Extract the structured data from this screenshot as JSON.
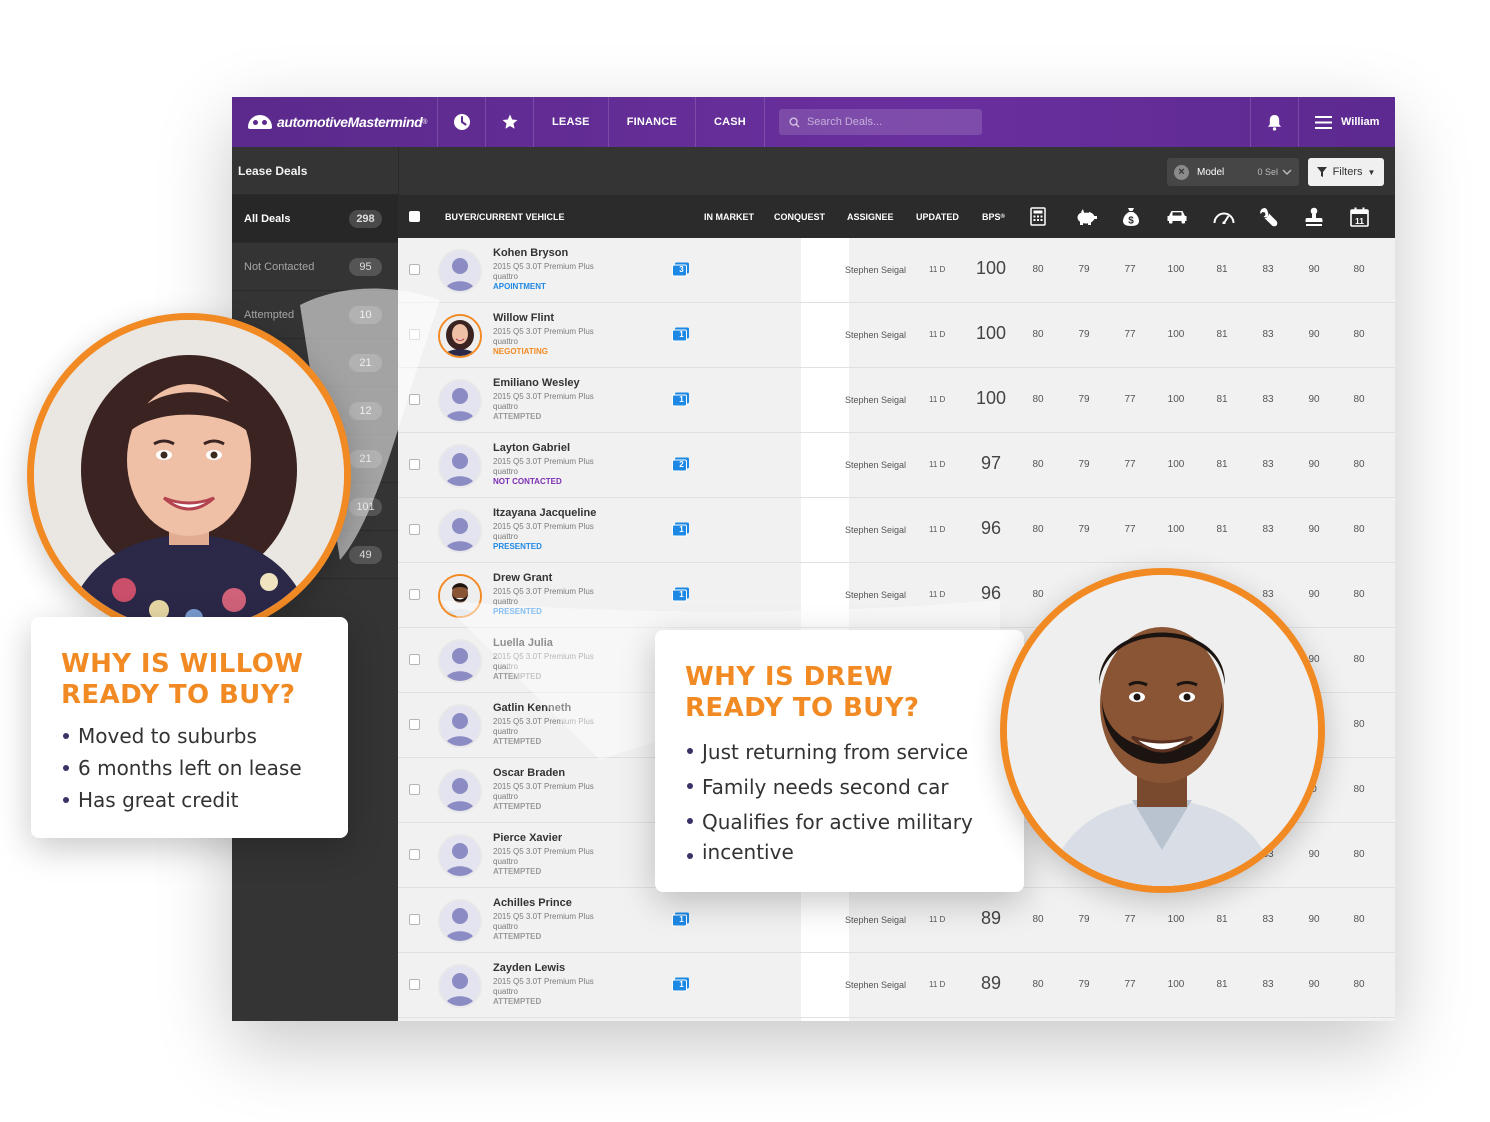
{
  "brand": {
    "name": "automotiveMastermind",
    "reg": "®"
  },
  "nav": {
    "links": [
      "LEASE",
      "FINANCE",
      "CASH"
    ],
    "search_placeholder": "Search Deals...",
    "user": "William"
  },
  "colors": {
    "topbar": "#5b2a8c",
    "accent": "#f28a24",
    "appointment": "#1e88e5",
    "negotiating": "#f28a24",
    "attempted": "#9a9a9a",
    "not_contacted": "#7b2fb5",
    "presented": "#1e88e5"
  },
  "sidebar": {
    "title": "Lease Deals",
    "items": [
      {
        "label": "All Deals",
        "count": "298"
      },
      {
        "label": "Not Contacted",
        "count": "95"
      },
      {
        "label": "Attempted",
        "count": "10"
      },
      {
        "label": "",
        "count": "21"
      },
      {
        "label": "",
        "count": "12"
      },
      {
        "label": "",
        "count": "21"
      },
      {
        "label": "",
        "count": "101"
      },
      {
        "label": "",
        "count": "49"
      }
    ]
  },
  "toolbar": {
    "model_label": "Model",
    "model_sel": "0 Sel",
    "filters_label": "Filters"
  },
  "table": {
    "headers": {
      "buyer": "BUYER/CURRENT VEHICLE",
      "in_market": "IN MARKET",
      "conquest": "CONQUEST",
      "assignee": "ASSIGNEE",
      "updated": "UPDATED",
      "bps": "BPS",
      "bps_sup": "®"
    },
    "icon_columns": [
      "calculator-icon",
      "piggy-bank-icon",
      "money-bag-icon",
      "car-icon",
      "speedometer-icon",
      "wrench-icon",
      "stamp-icon",
      "calendar-icon"
    ],
    "calendar_day": "11",
    "rows": [
      {
        "name": "Kohen Bryson",
        "vehicle": [
          "2015 Q5 3.0T Premium Plus",
          "quattro"
        ],
        "status": "APOINTMENT",
        "status_type": "appointment",
        "in_market": "3",
        "assignee": "Stephen Seigal",
        "updated": "11 D",
        "bps": "100",
        "scores": [
          "80",
          "79",
          "77",
          "100",
          "81",
          "83",
          "90",
          "80"
        ]
      },
      {
        "name": "Willow Flint",
        "vehicle": [
          "2015 Q5 3.0T Premium Plus",
          "quattro"
        ],
        "status": "NEGOTIATING",
        "status_type": "negotiating",
        "in_market": "1",
        "assignee": "Stephen Seigal",
        "updated": "11 D",
        "bps": "100",
        "scores": [
          "80",
          "79",
          "77",
          "100",
          "81",
          "83",
          "90",
          "80"
        ],
        "photo": "woman"
      },
      {
        "name": "Emiliano Wesley",
        "vehicle": [
          "2015 Q5 3.0T Premium Plus",
          "quattro"
        ],
        "status": "ATTEMPTED",
        "status_type": "attempted",
        "in_market": "1",
        "assignee": "Stephen Seigal",
        "updated": "11 D",
        "bps": "100",
        "scores": [
          "80",
          "79",
          "77",
          "100",
          "81",
          "83",
          "90",
          "80"
        ]
      },
      {
        "name": "Layton Gabriel",
        "vehicle": [
          "2015 Q5 3.0T Premium Plus",
          "quattro"
        ],
        "status": "NOT CONTACTED",
        "status_type": "not_contacted",
        "in_market": "2",
        "assignee": "Stephen Seigal",
        "updated": "11 D",
        "bps": "97",
        "scores": [
          "80",
          "79",
          "77",
          "100",
          "81",
          "83",
          "90",
          "80"
        ]
      },
      {
        "name": "Itzayana Jacqueline",
        "vehicle": [
          "2015 Q5 3.0T Premium Plus",
          "quattro"
        ],
        "status": "PRESENTED",
        "status_type": "presented",
        "in_market": "1",
        "assignee": "Stephen Seigal",
        "updated": "11 D",
        "bps": "96",
        "scores": [
          "80",
          "79",
          "77",
          "100",
          "81",
          "83",
          "90",
          "80"
        ]
      },
      {
        "name": "Drew Grant",
        "vehicle": [
          "2015 Q5 3.0T Premium Plus",
          "quattro"
        ],
        "status": "PRESENTED",
        "status_type": "presented",
        "in_market": "1",
        "assignee": "Stephen Seigal",
        "updated": "11 D",
        "bps": "96",
        "scores": [
          "80",
          "",
          "",
          "",
          "",
          "83",
          "90",
          "80"
        ],
        "photo": "man"
      },
      {
        "name": "Luella Julia",
        "vehicle": [
          "2015 Q5 3.0T Premium Plus",
          "quattro"
        ],
        "status": "ATTEMPTED",
        "status_type": "attempted",
        "in_market": "",
        "assignee": "",
        "updated": "",
        "bps": "",
        "scores": [
          "",
          "",
          "",
          "",
          "",
          "",
          "90",
          "80"
        ]
      },
      {
        "name": "Gatlin Kenneth",
        "vehicle": [
          "2015 Q5 3.0T Premium Plus",
          "quattro"
        ],
        "status": "ATTEMPTED",
        "status_type": "attempted",
        "in_market": "",
        "assignee": "",
        "updated": "",
        "bps": "",
        "scores": [
          "",
          "",
          "",
          "",
          "",
          "",
          "",
          "80"
        ]
      },
      {
        "name": "Oscar Braden",
        "vehicle": [
          "2015 Q5 3.0T Premium Plus",
          "quattro"
        ],
        "status": "ATTEMPTED",
        "status_type": "attempted",
        "in_market": "",
        "assignee": "",
        "updated": "",
        "bps": "",
        "scores": [
          "",
          "",
          "",
          "",
          "",
          "",
          "0",
          "80"
        ]
      },
      {
        "name": "Pierce Xavier",
        "vehicle": [
          "2015 Q5 3.0T Premium Plus",
          "quattro"
        ],
        "status": "ATTEMPTED",
        "status_type": "attempted",
        "in_market": "",
        "assignee": "",
        "updated": "",
        "bps": "",
        "scores": [
          "",
          "",
          "",
          "",
          "",
          "33",
          "90",
          "80"
        ]
      },
      {
        "name": "Achilles Prince",
        "vehicle": [
          "2015 Q5 3.0T Premium Plus",
          "quattro"
        ],
        "status": "ATTEMPTED",
        "status_type": "attempted",
        "in_market": "1",
        "assignee": "Stephen Seigal",
        "updated": "11 D",
        "bps": "89",
        "scores": [
          "80",
          "79",
          "77",
          "100",
          "81",
          "83",
          "90",
          "80"
        ]
      },
      {
        "name": "Zayden Lewis",
        "vehicle": [
          "2015 Q5 3.0T Premium Plus",
          "quattro"
        ],
        "status": "ATTEMPTED",
        "status_type": "attempted",
        "in_market": "1",
        "assignee": "Stephen Seigal",
        "updated": "11 D",
        "bps": "89",
        "scores": [
          "80",
          "79",
          "77",
          "100",
          "81",
          "83",
          "90",
          "80"
        ]
      }
    ]
  },
  "callouts": {
    "willow": {
      "title": [
        "WHY IS WILLOW",
        "READY TO BUY?"
      ],
      "points": [
        "Moved to suburbs",
        "6 months left on lease",
        "Has great credit"
      ]
    },
    "drew": {
      "title": [
        "WHY IS DREW",
        "READY TO BUY?"
      ],
      "points": [
        "Just returning from service",
        "Family needs second car",
        "Qualifies for active military",
        "incentive"
      ]
    }
  }
}
